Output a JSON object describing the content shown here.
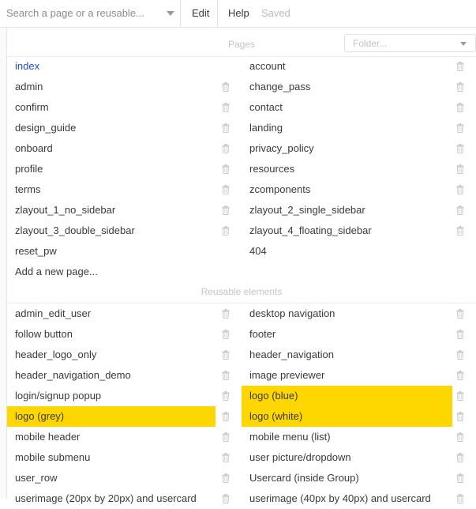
{
  "toolbar": {
    "search_placeholder": "Search a page or a reusable...",
    "edit": "Edit",
    "help": "Help",
    "saved": "Saved"
  },
  "pages_section": {
    "title": "Pages",
    "folder_placeholder": "Folder...",
    "add_page": "Add a new page...",
    "left": [
      {
        "label": "index",
        "trash": false,
        "active": true
      },
      {
        "label": "admin",
        "trash": true
      },
      {
        "label": "confirm",
        "trash": true
      },
      {
        "label": "design_guide",
        "trash": true
      },
      {
        "label": "onboard",
        "trash": true
      },
      {
        "label": "profile",
        "trash": true
      },
      {
        "label": "terms",
        "trash": true
      },
      {
        "label": "zlayout_1_no_sidebar",
        "trash": true
      },
      {
        "label": "zlayout_3_double_sidebar",
        "trash": true
      },
      {
        "label": "reset_pw",
        "trash": false
      }
    ],
    "right": [
      {
        "label": "account",
        "trash": true
      },
      {
        "label": "change_pass",
        "trash": true
      },
      {
        "label": "contact",
        "trash": true
      },
      {
        "label": "landing",
        "trash": true
      },
      {
        "label": "privacy_policy",
        "trash": true
      },
      {
        "label": "resources",
        "trash": true
      },
      {
        "label": "zcomponents",
        "trash": true
      },
      {
        "label": "zlayout_2_single_sidebar",
        "trash": true
      },
      {
        "label": "zlayout_4_floating_sidebar",
        "trash": true
      },
      {
        "label": "404",
        "trash": false
      }
    ]
  },
  "reusable_section": {
    "title": "Reusable elements",
    "left": [
      {
        "label": "admin_edit_user",
        "trash": true
      },
      {
        "label": "follow button",
        "trash": true
      },
      {
        "label": "header_logo_only",
        "trash": true
      },
      {
        "label": "header_navigation_demo",
        "trash": true
      },
      {
        "label": "login/signup popup",
        "trash": true
      },
      {
        "label": "logo (grey)",
        "trash": true,
        "highlight": true
      },
      {
        "label": "mobile header",
        "trash": true
      },
      {
        "label": "mobile submenu",
        "trash": true
      },
      {
        "label": "user_row",
        "trash": true
      },
      {
        "label": "userimage (20px by 20px) and usercard",
        "trash": true
      }
    ],
    "right": [
      {
        "label": "desktop navigation",
        "trash": true
      },
      {
        "label": "footer",
        "trash": true
      },
      {
        "label": "header_navigation",
        "trash": true
      },
      {
        "label": "image previewer",
        "trash": true
      },
      {
        "label": "logo (blue)",
        "trash": true,
        "highlight": true
      },
      {
        "label": "logo (white)",
        "trash": true,
        "highlight": true
      },
      {
        "label": "mobile menu (list)",
        "trash": true
      },
      {
        "label": "user picture/dropdown",
        "trash": true
      },
      {
        "label": "Usercard (inside Group)",
        "trash": true
      },
      {
        "label": "userimage (40px by 40px) and usercard",
        "trash": true
      }
    ]
  },
  "colors": {
    "highlight": "#ffd700",
    "active_link": "#1f4ecf"
  }
}
